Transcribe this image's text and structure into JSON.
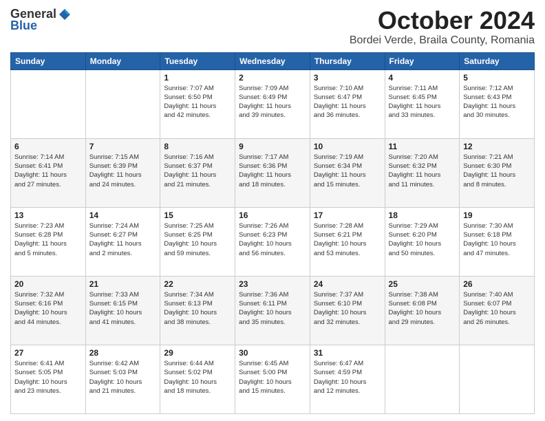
{
  "logo": {
    "general": "General",
    "blue": "Blue"
  },
  "title": "October 2024",
  "location": "Bordei Verde, Braila County, Romania",
  "days_of_week": [
    "Sunday",
    "Monday",
    "Tuesday",
    "Wednesday",
    "Thursday",
    "Friday",
    "Saturday"
  ],
  "weeks": [
    [
      {
        "day": "",
        "info": ""
      },
      {
        "day": "",
        "info": ""
      },
      {
        "day": "1",
        "info": "Sunrise: 7:07 AM\nSunset: 6:50 PM\nDaylight: 11 hours\nand 42 minutes."
      },
      {
        "day": "2",
        "info": "Sunrise: 7:09 AM\nSunset: 6:49 PM\nDaylight: 11 hours\nand 39 minutes."
      },
      {
        "day": "3",
        "info": "Sunrise: 7:10 AM\nSunset: 6:47 PM\nDaylight: 11 hours\nand 36 minutes."
      },
      {
        "day": "4",
        "info": "Sunrise: 7:11 AM\nSunset: 6:45 PM\nDaylight: 11 hours\nand 33 minutes."
      },
      {
        "day": "5",
        "info": "Sunrise: 7:12 AM\nSunset: 6:43 PM\nDaylight: 11 hours\nand 30 minutes."
      }
    ],
    [
      {
        "day": "6",
        "info": "Sunrise: 7:14 AM\nSunset: 6:41 PM\nDaylight: 11 hours\nand 27 minutes."
      },
      {
        "day": "7",
        "info": "Sunrise: 7:15 AM\nSunset: 6:39 PM\nDaylight: 11 hours\nand 24 minutes."
      },
      {
        "day": "8",
        "info": "Sunrise: 7:16 AM\nSunset: 6:37 PM\nDaylight: 11 hours\nand 21 minutes."
      },
      {
        "day": "9",
        "info": "Sunrise: 7:17 AM\nSunset: 6:36 PM\nDaylight: 11 hours\nand 18 minutes."
      },
      {
        "day": "10",
        "info": "Sunrise: 7:19 AM\nSunset: 6:34 PM\nDaylight: 11 hours\nand 15 minutes."
      },
      {
        "day": "11",
        "info": "Sunrise: 7:20 AM\nSunset: 6:32 PM\nDaylight: 11 hours\nand 11 minutes."
      },
      {
        "day": "12",
        "info": "Sunrise: 7:21 AM\nSunset: 6:30 PM\nDaylight: 11 hours\nand 8 minutes."
      }
    ],
    [
      {
        "day": "13",
        "info": "Sunrise: 7:23 AM\nSunset: 6:28 PM\nDaylight: 11 hours\nand 5 minutes."
      },
      {
        "day": "14",
        "info": "Sunrise: 7:24 AM\nSunset: 6:27 PM\nDaylight: 11 hours\nand 2 minutes."
      },
      {
        "day": "15",
        "info": "Sunrise: 7:25 AM\nSunset: 6:25 PM\nDaylight: 10 hours\nand 59 minutes."
      },
      {
        "day": "16",
        "info": "Sunrise: 7:26 AM\nSunset: 6:23 PM\nDaylight: 10 hours\nand 56 minutes."
      },
      {
        "day": "17",
        "info": "Sunrise: 7:28 AM\nSunset: 6:21 PM\nDaylight: 10 hours\nand 53 minutes."
      },
      {
        "day": "18",
        "info": "Sunrise: 7:29 AM\nSunset: 6:20 PM\nDaylight: 10 hours\nand 50 minutes."
      },
      {
        "day": "19",
        "info": "Sunrise: 7:30 AM\nSunset: 6:18 PM\nDaylight: 10 hours\nand 47 minutes."
      }
    ],
    [
      {
        "day": "20",
        "info": "Sunrise: 7:32 AM\nSunset: 6:16 PM\nDaylight: 10 hours\nand 44 minutes."
      },
      {
        "day": "21",
        "info": "Sunrise: 7:33 AM\nSunset: 6:15 PM\nDaylight: 10 hours\nand 41 minutes."
      },
      {
        "day": "22",
        "info": "Sunrise: 7:34 AM\nSunset: 6:13 PM\nDaylight: 10 hours\nand 38 minutes."
      },
      {
        "day": "23",
        "info": "Sunrise: 7:36 AM\nSunset: 6:11 PM\nDaylight: 10 hours\nand 35 minutes."
      },
      {
        "day": "24",
        "info": "Sunrise: 7:37 AM\nSunset: 6:10 PM\nDaylight: 10 hours\nand 32 minutes."
      },
      {
        "day": "25",
        "info": "Sunrise: 7:38 AM\nSunset: 6:08 PM\nDaylight: 10 hours\nand 29 minutes."
      },
      {
        "day": "26",
        "info": "Sunrise: 7:40 AM\nSunset: 6:07 PM\nDaylight: 10 hours\nand 26 minutes."
      }
    ],
    [
      {
        "day": "27",
        "info": "Sunrise: 6:41 AM\nSunset: 5:05 PM\nDaylight: 10 hours\nand 23 minutes."
      },
      {
        "day": "28",
        "info": "Sunrise: 6:42 AM\nSunset: 5:03 PM\nDaylight: 10 hours\nand 21 minutes."
      },
      {
        "day": "29",
        "info": "Sunrise: 6:44 AM\nSunset: 5:02 PM\nDaylight: 10 hours\nand 18 minutes."
      },
      {
        "day": "30",
        "info": "Sunrise: 6:45 AM\nSunset: 5:00 PM\nDaylight: 10 hours\nand 15 minutes."
      },
      {
        "day": "31",
        "info": "Sunrise: 6:47 AM\nSunset: 4:59 PM\nDaylight: 10 hours\nand 12 minutes."
      },
      {
        "day": "",
        "info": ""
      },
      {
        "day": "",
        "info": ""
      }
    ]
  ]
}
